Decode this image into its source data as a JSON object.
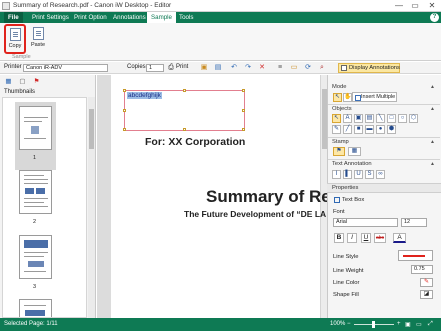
{
  "window": {
    "title": "Summary of Research.pdf - Canon iW Desktop - Editor",
    "minimize": "—",
    "restore": "▭",
    "close": "✕"
  },
  "ribbon_tabs": [
    "File",
    "Print Settings",
    "Print Option",
    "Annotations",
    "Sample",
    "Tools"
  ],
  "active_tab": "Sample",
  "help": "?",
  "ribbon": {
    "copy_label": "Copy",
    "paste_label": "Paste",
    "group_label": "Sample"
  },
  "toolbar": {
    "printer_label": "Printer",
    "printer_value": "Canon iR-ADV",
    "copies_label": "Copies",
    "copies_value": "1",
    "print_label": "Print",
    "display_annotations": "Display Annotations"
  },
  "left_panel": {
    "thumbnails_label": "Thumbnails",
    "page_numbers": [
      "1",
      "2",
      "3"
    ]
  },
  "document": {
    "textbox_text": "abcdefghijk",
    "for_line": "For: XX Corporation",
    "title": "Summary of Res",
    "subtitle": "The Future Development of “DE LA"
  },
  "right_panel": {
    "mode_label": "Mode",
    "insert_multiple": "Insert Multiple",
    "objects_label": "Objects",
    "stamp_label": "Stamp",
    "text_annotation_label": "Text Annotation",
    "properties_label": "Properties",
    "object_type": "Text Box",
    "font_label": "Font",
    "font_name": "Arial",
    "font_size": "12",
    "bold": "B",
    "italic": "I",
    "underline": "U",
    "strikethrough": "abc",
    "font_color": "A",
    "line_style_label": "Line Style",
    "line_weight_label": "Line Weight",
    "line_weight_value": "0.75",
    "line_color_label": "Line Color",
    "shape_fill_label": "Shape Fill"
  },
  "status": {
    "selected_page": "Selected Page: 1/11",
    "zoom": "100%"
  },
  "colors": {
    "accent": "#0e7a54",
    "highlight": "#fde7a6",
    "callout": "#e0231c",
    "line_color": "#e0231c"
  }
}
